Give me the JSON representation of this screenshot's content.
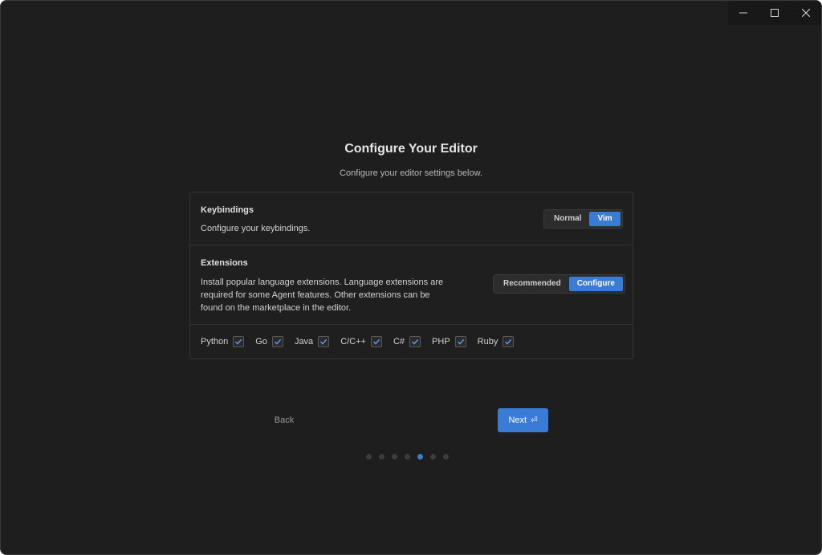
{
  "window_controls": {
    "minimize_icon": "minimize-icon",
    "maximize_icon": "maximize-icon",
    "close_icon": "close-icon"
  },
  "page": {
    "title": "Configure Your Editor",
    "subtitle": "Configure your editor settings below."
  },
  "keybindings": {
    "heading": "Keybindings",
    "description": "Configure your keybindings.",
    "options": [
      "Normal",
      "Vim"
    ],
    "selected": "Vim"
  },
  "extensions": {
    "heading": "Extensions",
    "description": "Install popular language extensions. Language extensions are required for some Agent features. Other extensions can be found on the marketplace in the editor.",
    "options": [
      "Recommended",
      "Configure"
    ],
    "selected": "Configure"
  },
  "languages": [
    {
      "label": "Python",
      "checked": true
    },
    {
      "label": "Go",
      "checked": true
    },
    {
      "label": "Java",
      "checked": true
    },
    {
      "label": "C/C++",
      "checked": true
    },
    {
      "label": "C#",
      "checked": true
    },
    {
      "label": "PHP",
      "checked": true
    },
    {
      "label": "Ruby",
      "checked": true
    }
  ],
  "navigation": {
    "back_label": "Back",
    "next_label": "Next",
    "next_glyph": "⏎"
  },
  "progress": {
    "total_steps": 7,
    "current_step": 5
  },
  "colors": {
    "accent": "#3a7bd5",
    "background": "#1e1e1e"
  }
}
